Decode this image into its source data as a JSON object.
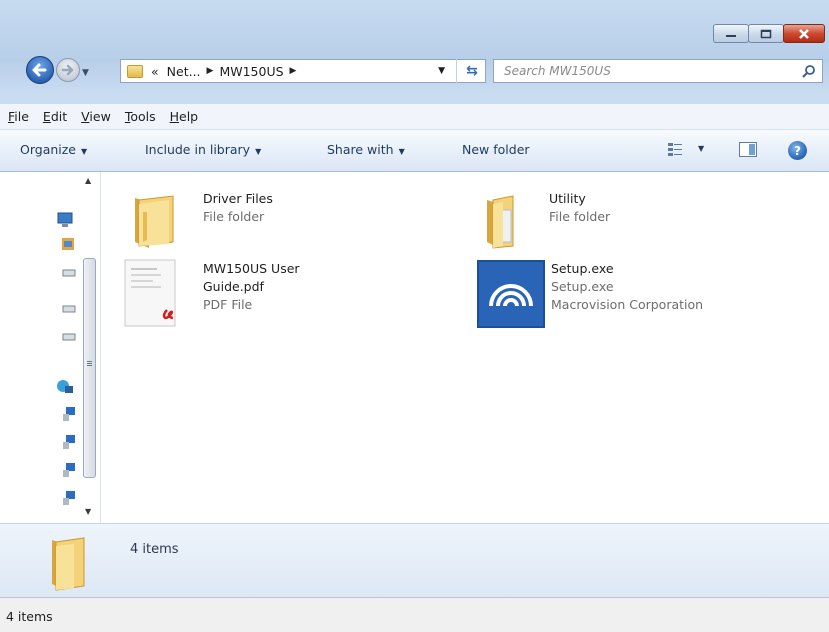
{
  "window": {
    "buttons": {
      "minimize": "minimize-icon",
      "maximize": "maximize-icon",
      "close": "close-icon"
    }
  },
  "address": {
    "overflow": "«",
    "crumbs": [
      "Net...",
      "MW150US"
    ],
    "search_placeholder": "Search MW150US"
  },
  "menu": [
    {
      "underline": "F",
      "rest": "ile"
    },
    {
      "underline": "E",
      "rest": "dit"
    },
    {
      "underline": "V",
      "rest": "iew"
    },
    {
      "underline": "T",
      "rest": "ools"
    },
    {
      "underline": "H",
      "rest": "elp"
    }
  ],
  "toolbar": {
    "organize": "Organize",
    "include": "Include in library",
    "share": "Share with",
    "new_folder": "New folder"
  },
  "items": [
    {
      "name": "Driver Files",
      "line2": "File folder",
      "icon": "folder-icon"
    },
    {
      "name": "Utility",
      "line2": "File folder",
      "icon": "folder-icon"
    },
    {
      "name": "MW150US User",
      "name2": "Guide.pdf",
      "line2": "PDF File",
      "icon": "pdf-file-icon"
    },
    {
      "name": "Setup.exe",
      "line2": "Setup.exe",
      "line3": "Macrovision Corporation",
      "icon": "setup-app-icon"
    }
  ],
  "details": {
    "count": "4 items"
  },
  "status": {
    "count": "4 items"
  },
  "colors": {
    "accent": "#2a63b6",
    "close": "#cc4b32",
    "folder": "#e5b94b"
  }
}
